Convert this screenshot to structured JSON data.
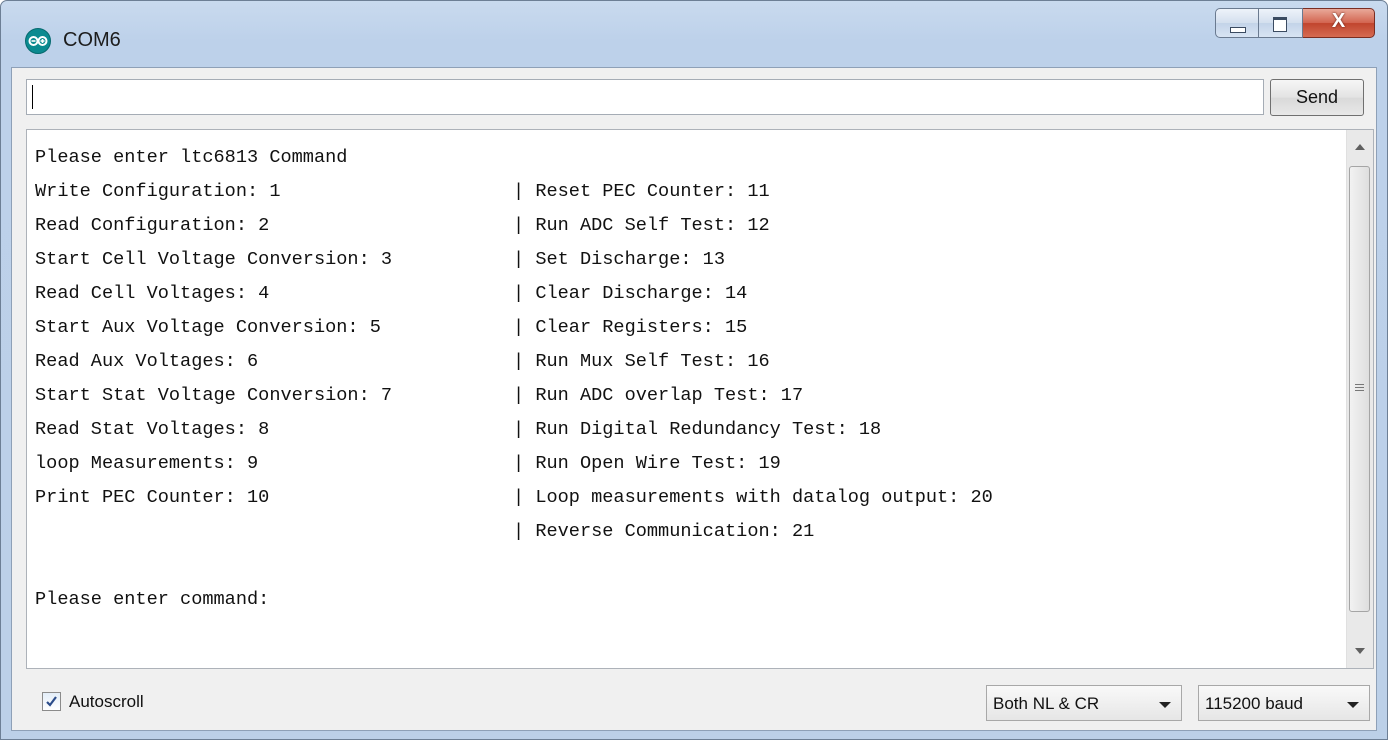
{
  "window": {
    "title": "COM6",
    "close_glyph": "X"
  },
  "input": {
    "value": "",
    "send_label": "Send"
  },
  "output": {
    "header": "Please enter ltc6813 Command",
    "rows": [
      {
        "left": "Write Configuration: 1",
        "right": "| Reset PEC Counter: 11"
      },
      {
        "left": "Read Configuration: 2",
        "right": "| Run ADC Self Test: 12"
      },
      {
        "left": "Start Cell Voltage Conversion: 3",
        "right": "| Set Discharge: 13"
      },
      {
        "left": "Read Cell Voltages: 4",
        "right": "| Clear Discharge: 14"
      },
      {
        "left": "Start Aux Voltage Conversion: 5",
        "right": "| Clear Registers: 15"
      },
      {
        "left": "Read Aux Voltages: 6",
        "right": "| Run Mux Self Test: 16"
      },
      {
        "left": "Start Stat Voltage Conversion: 7",
        "right": "| Run ADC overlap Test: 17"
      },
      {
        "left": "Read Stat Voltages: 8",
        "right": "| Run Digital Redundancy Test: 18"
      },
      {
        "left": "loop Measurements: 9",
        "right": "| Run Open Wire Test: 19"
      },
      {
        "left": "Print PEC Counter: 10",
        "right": "| Loop measurements with datalog output: 20"
      },
      {
        "left": "",
        "right": "| Reverse Communication: 21"
      }
    ],
    "prompt": "Please enter command:"
  },
  "footer": {
    "autoscroll_label": "Autoscroll",
    "autoscroll_checked": true,
    "line_ending": "Both NL & CR",
    "baud": "115200 baud"
  },
  "icons": {
    "app": "arduino-icon",
    "minimize": "minimize-icon",
    "maximize": "maximize-icon",
    "close": "close-icon"
  }
}
